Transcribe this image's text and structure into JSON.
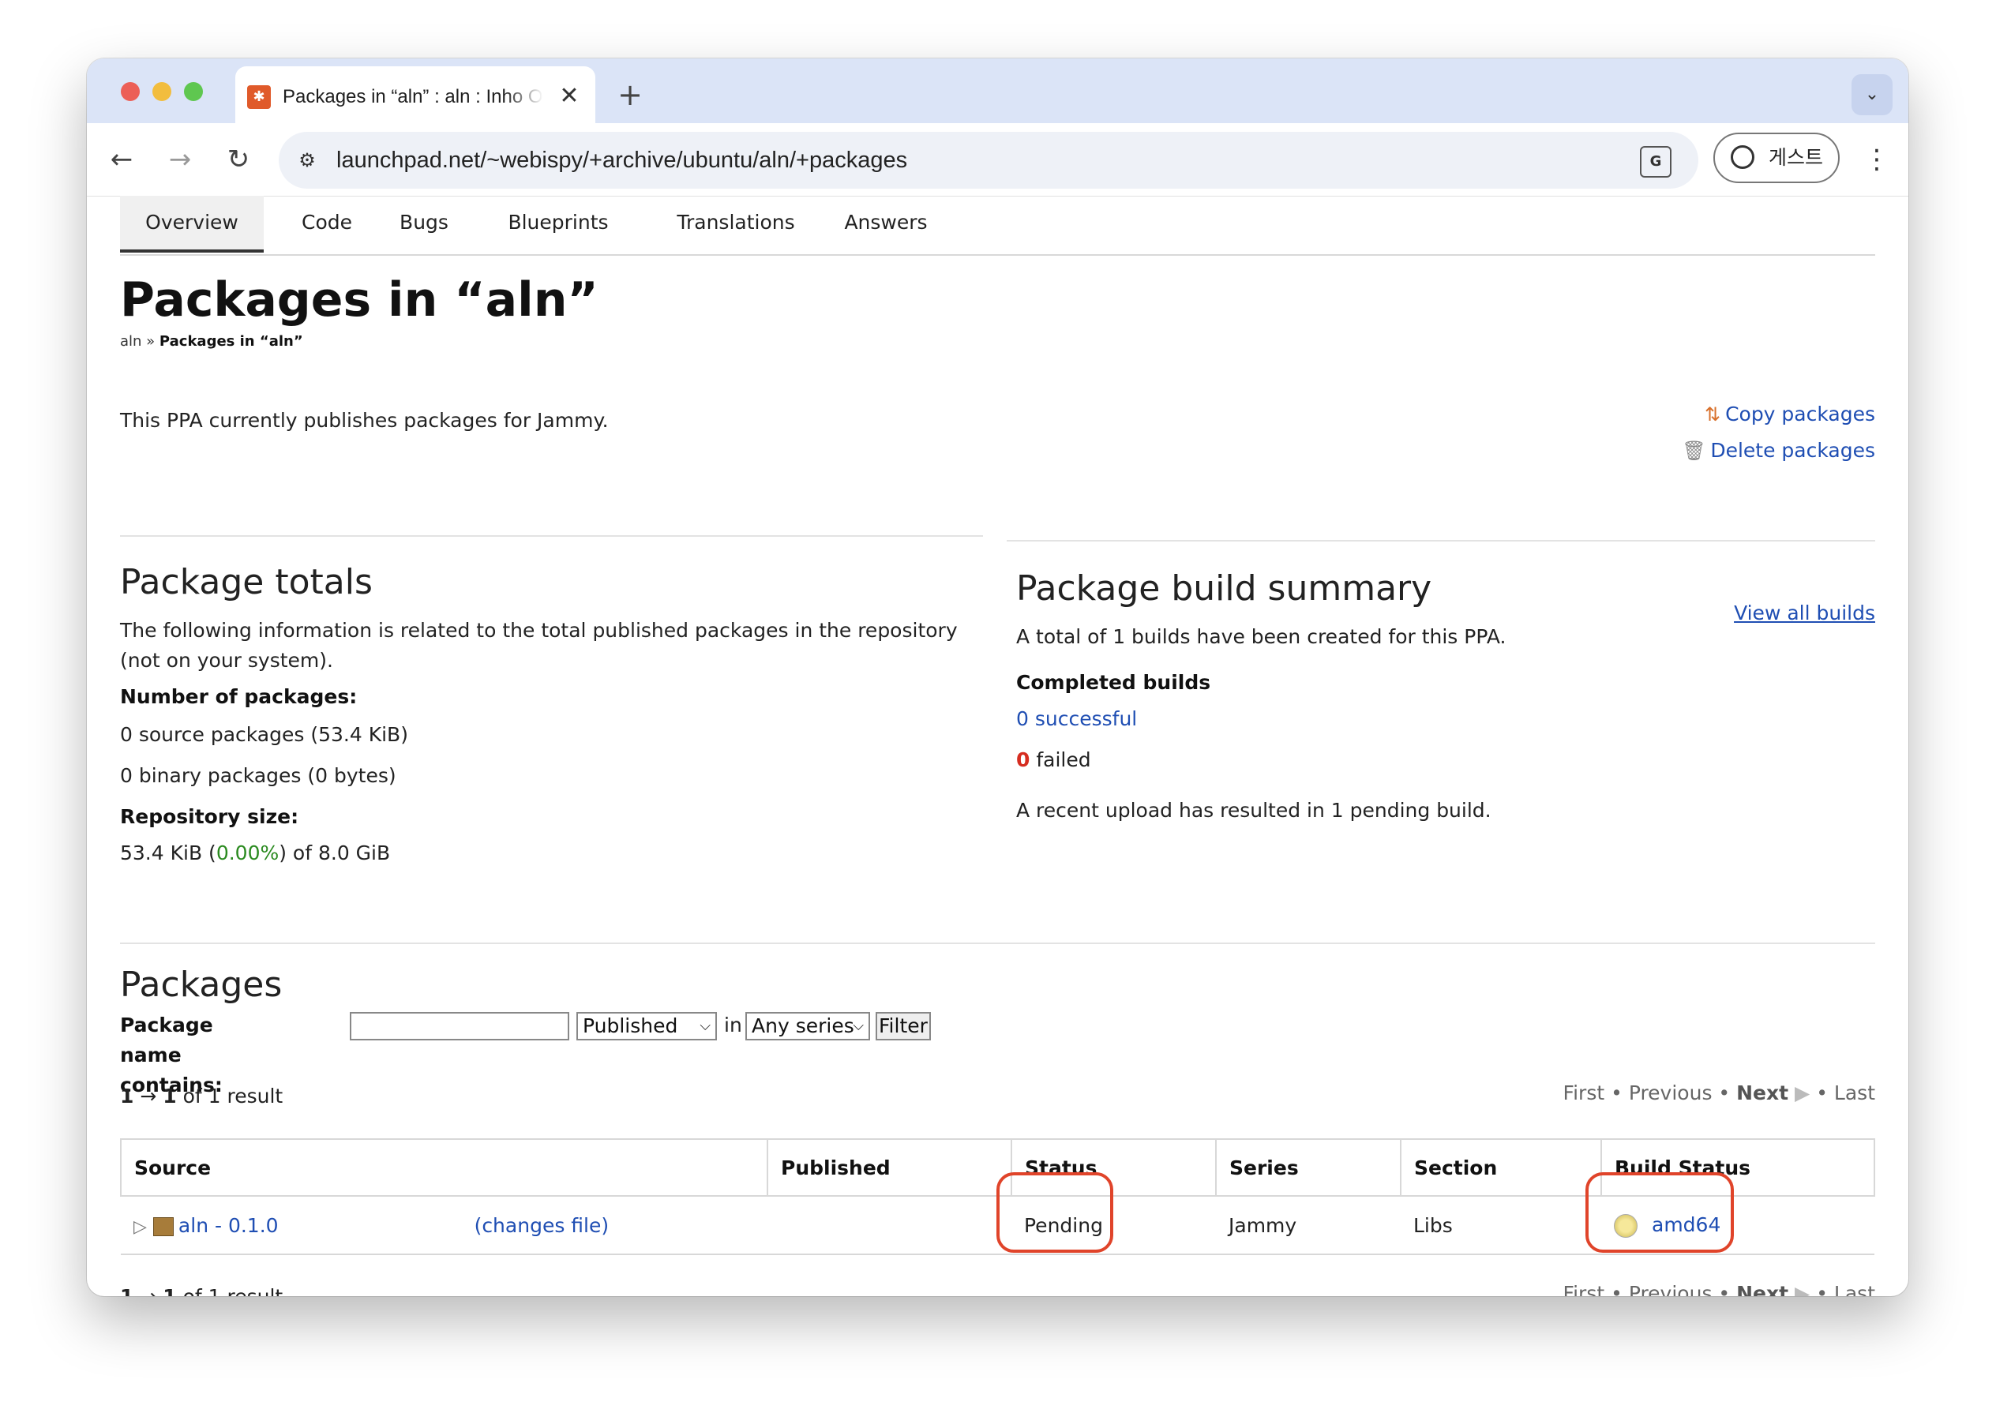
{
  "browser": {
    "tab_title": "Packages in “aln” : aln : Inho Oh",
    "tab_close": "✕",
    "new_tab": "+",
    "tab_menu": "⌄",
    "back": "←",
    "forward": "→",
    "reload": "↻",
    "url": "launchpad.net/~webispy/+archive/ubuntu/aln/+packages",
    "profile_label": "게스트",
    "menu": "⋮"
  },
  "nav_tabs": [
    "Overview",
    "Code",
    "Bugs",
    "Blueprints",
    "Translations",
    "Answers"
  ],
  "page": {
    "title": "Packages in “aln”",
    "breadcrumb_parent": "aln",
    "breadcrumb_sep": " » ",
    "breadcrumb_current": "Packages in “aln”",
    "ppa_description": "This PPA currently publishes packages for Jammy.",
    "copy_packages": "Copy packages",
    "delete_packages": "Delete packages"
  },
  "totals": {
    "heading": "Package totals",
    "description": "The following information is related to the total published packages in the repository (not on your system).",
    "num_packages_label": "Number of packages:",
    "source_packages": "0 source packages (53.4 KiB)",
    "binary_packages": "0 binary packages (0 bytes)",
    "repo_size_label": "Repository size:",
    "repo_size_prefix": "53.4 KiB (",
    "repo_size_percent": "0.00%",
    "repo_size_suffix": ") of 8.0 GiB"
  },
  "build_summary": {
    "heading": "Package build summary",
    "view_all": "View all builds",
    "description": "A total of 1 builds have been created for this PPA.",
    "completed_label": "Completed builds",
    "successful": "0 successful",
    "failed_count": "0",
    "failed_label": " failed",
    "pending_note": "A recent upload has resulted in 1 pending build."
  },
  "packages": {
    "heading": "Packages",
    "filter_label": "Package name contains:",
    "filter_value": "",
    "status_select": "Published",
    "in_label": "in",
    "series_select": "Any series",
    "filter_button": "Filter",
    "result_range_start": "1",
    "result_range_arrow": " → ",
    "result_range_end": "1",
    "result_suffix": " of 1 result",
    "pager": {
      "first": "First",
      "previous": "Previous",
      "next": "Next",
      "last": "Last",
      "sep": "•"
    },
    "columns": [
      "Source",
      "Published",
      "Status",
      "Series",
      "Section",
      "Build Status"
    ],
    "rows": [
      {
        "source": "aln - 0.1.0",
        "changes": "(changes file)",
        "published": "",
        "status": "Pending",
        "series": "Jammy",
        "section": "Libs",
        "build": "amd64"
      }
    ]
  },
  "colors": {
    "annotation": "#e0442a",
    "link": "#1f4eb3",
    "accent_green": "#2a8a1f",
    "accent_red": "#d62d20"
  }
}
